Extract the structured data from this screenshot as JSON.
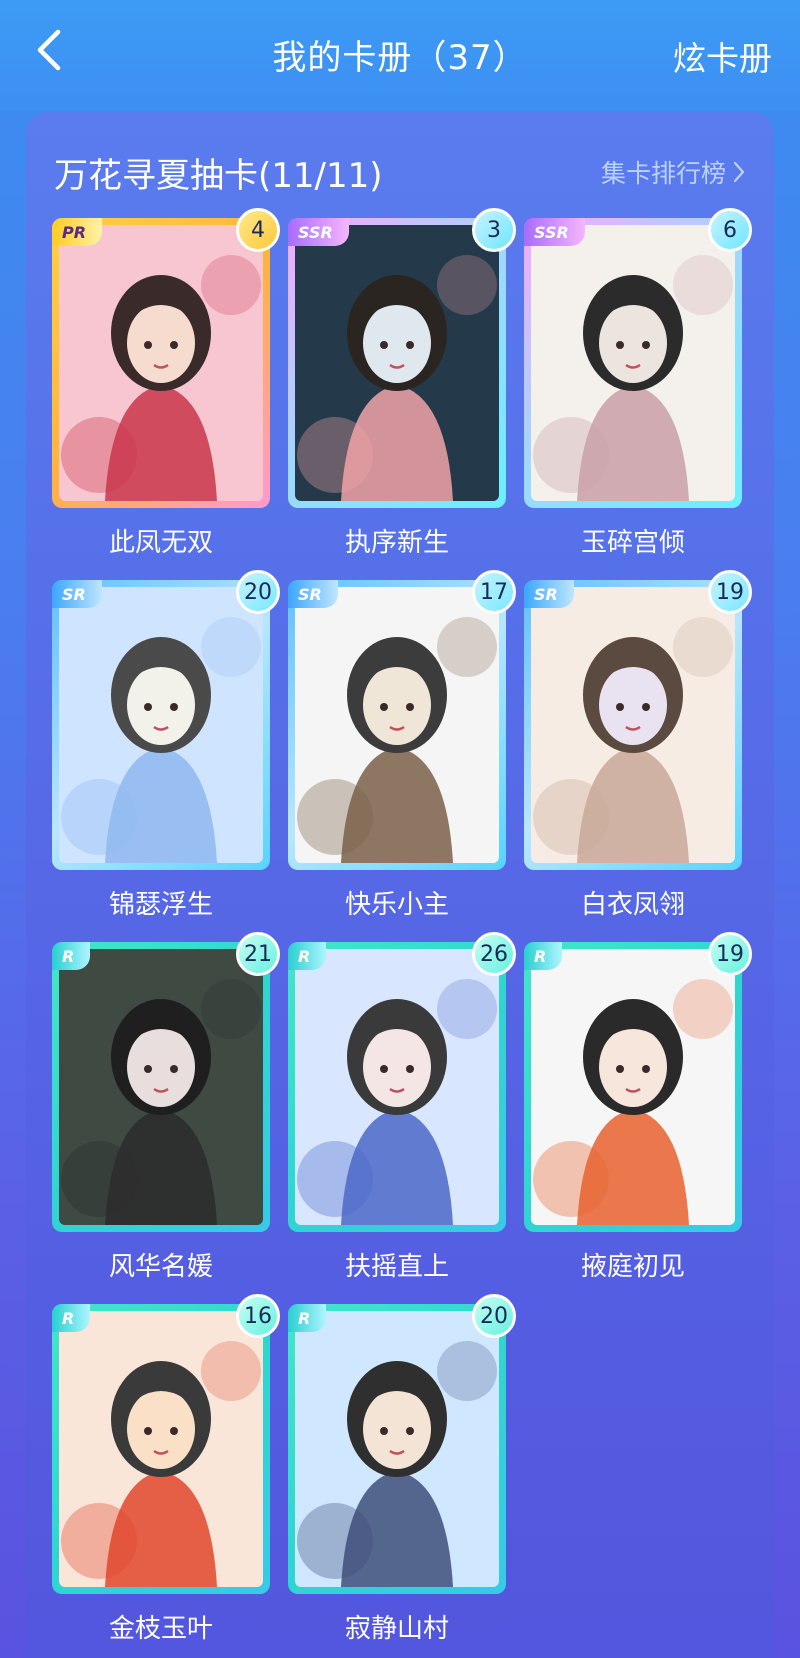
{
  "header": {
    "title": "我的卡册（37）",
    "show_label": "炫卡册"
  },
  "album": {
    "title": "万花寻夏抽卡(11/11)",
    "rank_label": "集卡排行榜"
  },
  "cards": [
    {
      "rarity": "PR",
      "count": "4",
      "name": "此凤无双",
      "theme": "pr"
    },
    {
      "rarity": "SSR",
      "count": "3",
      "name": "执序新生",
      "theme": "ssr"
    },
    {
      "rarity": "SSR",
      "count": "6",
      "name": "玉碎宫倾",
      "theme": "ssr"
    },
    {
      "rarity": "SR",
      "count": "20",
      "name": "锦瑟浮生",
      "theme": "sr"
    },
    {
      "rarity": "SR",
      "count": "17",
      "name": "快乐小主",
      "theme": "sr"
    },
    {
      "rarity": "SR",
      "count": "19",
      "name": "白衣凤翎",
      "theme": "sr"
    },
    {
      "rarity": "R",
      "count": "21",
      "name": "风华名媛",
      "theme": "r"
    },
    {
      "rarity": "R",
      "count": "26",
      "name": "扶摇直上",
      "theme": "r"
    },
    {
      "rarity": "R",
      "count": "19",
      "name": "掖庭初见",
      "theme": "r"
    },
    {
      "rarity": "R",
      "count": "16",
      "name": "金枝玉叶",
      "theme": "r"
    },
    {
      "rarity": "R",
      "count": "20",
      "name": "寂静山村",
      "theme": "r"
    }
  ],
  "icons": {
    "back": "chevron-left-icon",
    "rank": "chevron-right-icon"
  },
  "colors": {
    "header_bg": "#3d9bf5",
    "panel_bg": "#5670ea",
    "text": "#ffffff",
    "link": "#bcd2ff"
  }
}
